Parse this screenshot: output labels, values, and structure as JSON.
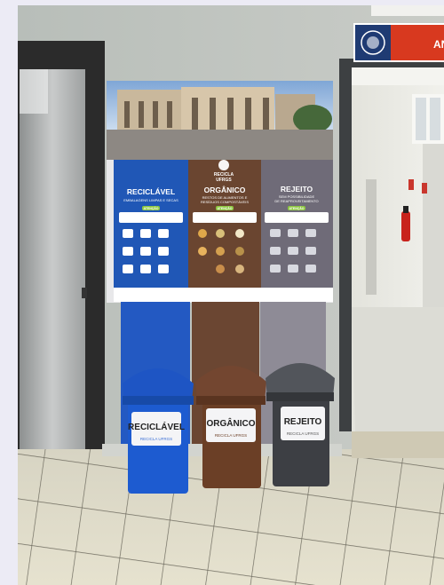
{
  "poster": {
    "logo_line1": "RECICLA",
    "logo_line2": "UFRGS",
    "columns": [
      {
        "title": "RECICLÁVEL",
        "subtitle_line1": "EMBALAGENS LIMPAS E SECAS",
        "attention": "ATENÇÃO",
        "color": "#2057b6"
      },
      {
        "title": "ORGÂNICO",
        "subtitle_line1": "RESTOS DE ALIMENTOS E",
        "subtitle_line2": "RESÍDUOS COMPOSTÁVEIS",
        "attention": "ATENÇÃO",
        "color": "#6a4530"
      },
      {
        "title": "REJEITO",
        "subtitle_line1": "SEM POSSIBILIDADE",
        "subtitle_line2": "DE REAPROVEITAMENTO",
        "attention": "ATENÇÃO",
        "color": "#6f6b78"
      }
    ]
  },
  "bins": [
    {
      "label": "RECICLÁVEL",
      "brand": "RECICLA UFRGS",
      "color": "#1d5bd0"
    },
    {
      "label": "ORGÂNICO",
      "brand": "RECICLA UFRGS",
      "color": "#6b3f26"
    },
    {
      "label": "REJEITO",
      "brand": "RECICLA UFRGS",
      "color": "#3d3f44"
    }
  ],
  "door_sign": {
    "text": "AN",
    "color": "#d8391f"
  }
}
